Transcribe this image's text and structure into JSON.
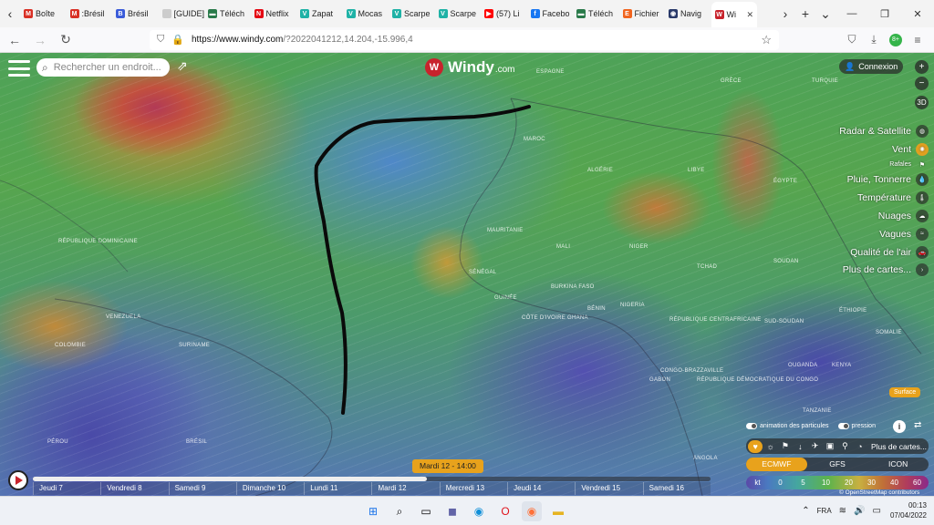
{
  "browser": {
    "tabs": [
      {
        "label": "Boîte",
        "icon": "gmail-icon",
        "color": "#d93025",
        "glyph": "M"
      },
      {
        "label": ":Brésil",
        "icon": "gmail-icon",
        "color": "#d93025",
        "glyph": "M"
      },
      {
        "label": "Brésil",
        "icon": "site-icon",
        "color": "#3a5bd9",
        "glyph": "B"
      },
      {
        "label": "[GUIDE] L",
        "icon": "blank-icon",
        "color": "#cccccc",
        "glyph": ""
      },
      {
        "label": "Téléch",
        "icon": "download-icon",
        "color": "#2a7a4a",
        "glyph": "▬"
      },
      {
        "label": "Netflix",
        "icon": "netflix-icon",
        "color": "#e50914",
        "glyph": "N"
      },
      {
        "label": "Zapat",
        "icon": "v-icon",
        "color": "#1fb2a6",
        "glyph": "V"
      },
      {
        "label": "Mocas",
        "icon": "v-icon",
        "color": "#1fb2a6",
        "glyph": "V"
      },
      {
        "label": "Scarpe",
        "icon": "v-icon",
        "color": "#1fb2a6",
        "glyph": "V"
      },
      {
        "label": "Scarpe",
        "icon": "v-icon",
        "color": "#1fb2a6",
        "glyph": "V"
      },
      {
        "label": "(57) Li",
        "icon": "youtube-icon",
        "color": "#ff0000",
        "glyph": "▶"
      },
      {
        "label": "Facebo",
        "icon": "facebook-icon",
        "color": "#1877f2",
        "glyph": "f"
      },
      {
        "label": "Téléch",
        "icon": "download-icon",
        "color": "#2a7a4a",
        "glyph": "▬"
      },
      {
        "label": "Fichier",
        "icon": "etsy-icon",
        "color": "#f1641e",
        "glyph": "E"
      },
      {
        "label": "Navig",
        "icon": "globe-icon",
        "color": "#2a3a6a",
        "glyph": "◉"
      },
      {
        "label": "Wi",
        "icon": "windy-icon",
        "color": "#c8232c",
        "glyph": "W",
        "active": true
      }
    ],
    "url_host": "https://www.windy.com",
    "url_rest": "/?2022041212,14.204,-15.996,4"
  },
  "windy": {
    "logo_text": "Windy",
    "logo_domain": ".com",
    "search_placeholder": "Rechercher un endroit...",
    "login_label": "Connexion",
    "view_3d": "3D",
    "layers": [
      {
        "label": "Radar & Satellite",
        "icon": "radar-icon",
        "glyph": "◍"
      },
      {
        "label": "Vent",
        "icon": "wind-icon",
        "glyph": "✺",
        "active": true
      },
      {
        "label": "Rafales",
        "icon": "flag-icon",
        "glyph": "⚑",
        "sub": true
      },
      {
        "label": "Pluie, Tonnerre",
        "icon": "rain-icon",
        "glyph": "💧"
      },
      {
        "label": "Température",
        "icon": "thermometer-icon",
        "glyph": "🌡"
      },
      {
        "label": "Nuages",
        "icon": "cloud-icon",
        "glyph": "☁"
      },
      {
        "label": "Vagues",
        "icon": "waves-icon",
        "glyph": "≈"
      },
      {
        "label": "Qualité de l'air",
        "icon": "car-icon",
        "glyph": "🚗"
      },
      {
        "label": "Plus de cartes...",
        "icon": "chevron-right-icon",
        "glyph": "›"
      }
    ],
    "surface_label": "Surface",
    "particles_label": "animation des particules",
    "pressure_label": "pression",
    "more_maps_label": "Plus de cartes...",
    "models": [
      "ECMWF",
      "GFS",
      "ICON"
    ],
    "legend_unit": "kt",
    "legend_values": [
      "0",
      "5",
      "10",
      "20",
      "30",
      "40",
      "60"
    ],
    "osm_credit": "© OpenStreetMap contributors",
    "timeline": {
      "current": "Mardi 12 - 14:00",
      "days": [
        "Jeudi 7",
        "Vendredi 8",
        "Samedi 9",
        "Dimanche 10",
        "Lundi 11",
        "Mardi 12",
        "Mercredi 13",
        "Jeudi 14",
        "Vendredi 15",
        "Samedi 16"
      ]
    },
    "map_labels": [
      {
        "text": "ESPAGNE"
      },
      {
        "text": "MAROC"
      },
      {
        "text": "ALGÉRIE"
      },
      {
        "text": "LIBYE"
      },
      {
        "text": "ÉGYPTE"
      },
      {
        "text": "MAURITANIE"
      },
      {
        "text": "MALI"
      },
      {
        "text": "NIGER"
      },
      {
        "text": "TCHAD"
      },
      {
        "text": "SOUDAN"
      },
      {
        "text": "SÉNÉGAL"
      },
      {
        "text": "GUINÉE"
      },
      {
        "text": "BURKINA FASO"
      },
      {
        "text": "CÔTE D'IVOIRE"
      },
      {
        "text": "GHANA"
      },
      {
        "text": "BÉNIN"
      },
      {
        "text": "NIGERIA"
      },
      {
        "text": "RÉPUBLIQUE CENTRAFRICAINE"
      },
      {
        "text": "SUD-SOUDAN"
      },
      {
        "text": "ÉTHIOPIE"
      },
      {
        "text": "SOMALIE"
      },
      {
        "text": "KENYA"
      },
      {
        "text": "OUGANDA"
      },
      {
        "text": "GABON"
      },
      {
        "text": "CONGO-BRAZZAVILLE"
      },
      {
        "text": "RÉPUBLIQUE DÉMOCRATIQUE DU CONGO"
      },
      {
        "text": "TANZANIE"
      },
      {
        "text": "ANGOLA"
      },
      {
        "text": "VENEZUELA"
      },
      {
        "text": "COLOMBIE"
      },
      {
        "text": "SURINAME"
      },
      {
        "text": "PÉROU"
      },
      {
        "text": "BRÉSIL"
      },
      {
        "text": "TURQUIE"
      },
      {
        "text": "GRÈCE"
      },
      {
        "text": "RÉPUBLIQUE DOMINICAINE"
      }
    ]
  },
  "taskbar": {
    "language": "FRA",
    "time": "00:13",
    "date": "07/04/2022"
  }
}
